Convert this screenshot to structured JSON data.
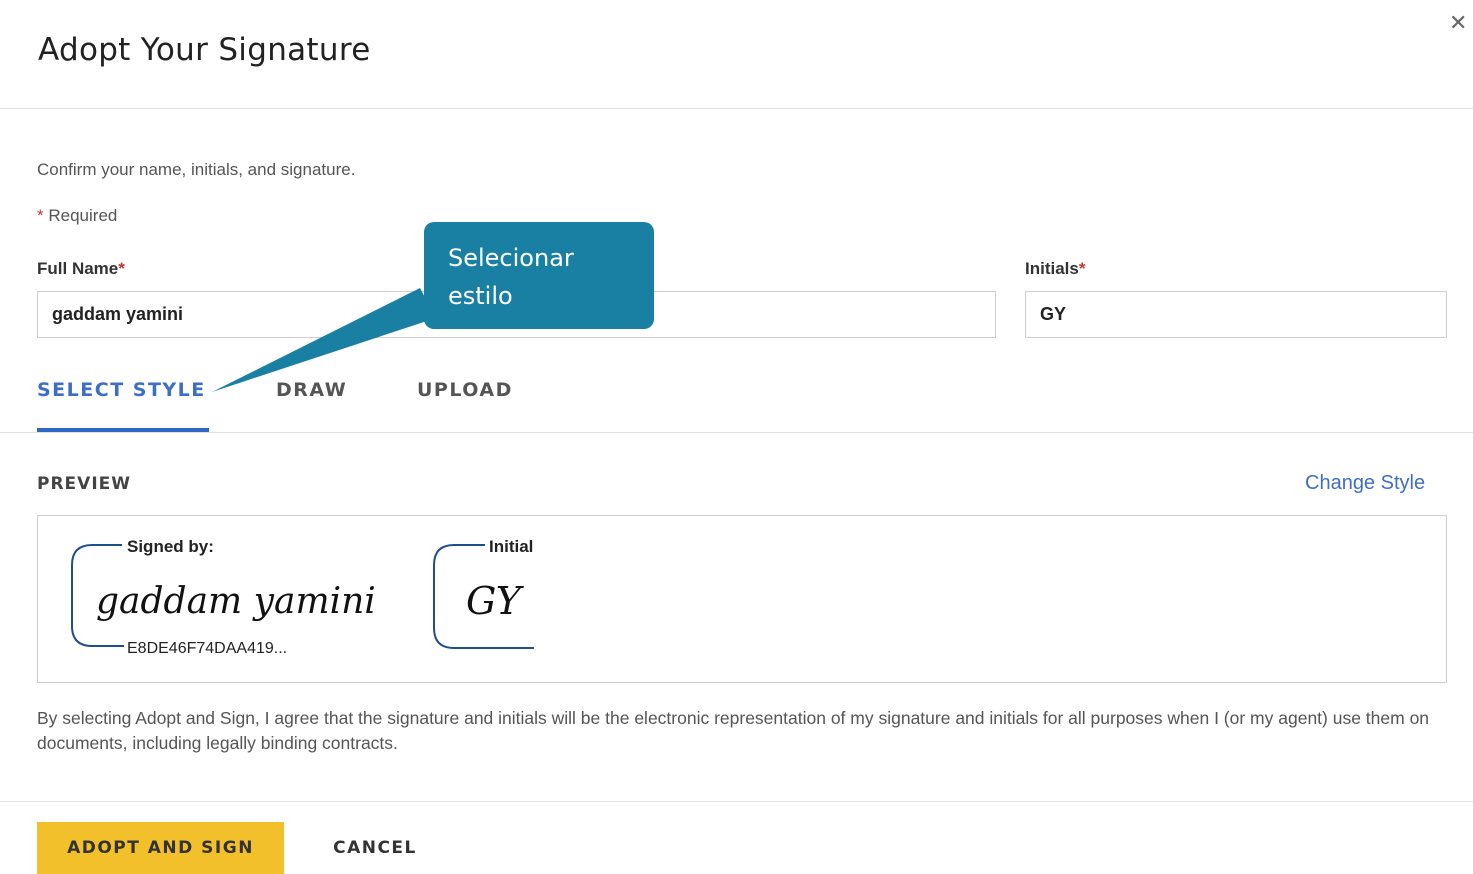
{
  "dialog": {
    "title": "Adopt Your Signature",
    "close_icon": "close-icon",
    "intro": "Confirm your name, initials, and signature.",
    "required_note": "Required",
    "required_mark": "*"
  },
  "form": {
    "full_name_label": "Full Name",
    "full_name_value": "gaddam yamini",
    "initials_label": "Initials",
    "initials_value": "GY"
  },
  "tabs": [
    {
      "label": "SELECT STYLE",
      "active": true
    },
    {
      "label": "DRAW",
      "active": false
    },
    {
      "label": "UPLOAD",
      "active": false
    }
  ],
  "preview": {
    "label": "PREVIEW",
    "change_style": "Change Style",
    "signature": {
      "signed_by_label": "Signed by:",
      "name_script": "gaddam yamini",
      "id": "E8DE46F74DAA419..."
    },
    "initial": {
      "label": "Initial",
      "script": "GY"
    }
  },
  "disclaimer": "By selecting Adopt and Sign, I agree that the signature and initials will be the electronic representation of my signature and initials for all purposes when I (or my agent) use them on documents, including legally binding contracts.",
  "actions": {
    "adopt": "ADOPT AND SIGN",
    "cancel": "CANCEL"
  },
  "callout": {
    "line1": "Selecionar",
    "line2": "estilo"
  },
  "colors": {
    "accent": "#3d6fc5",
    "adopt_button": "#f2c02b",
    "callout": "#1a80a3",
    "signature_frame": "#1f4e8c"
  }
}
